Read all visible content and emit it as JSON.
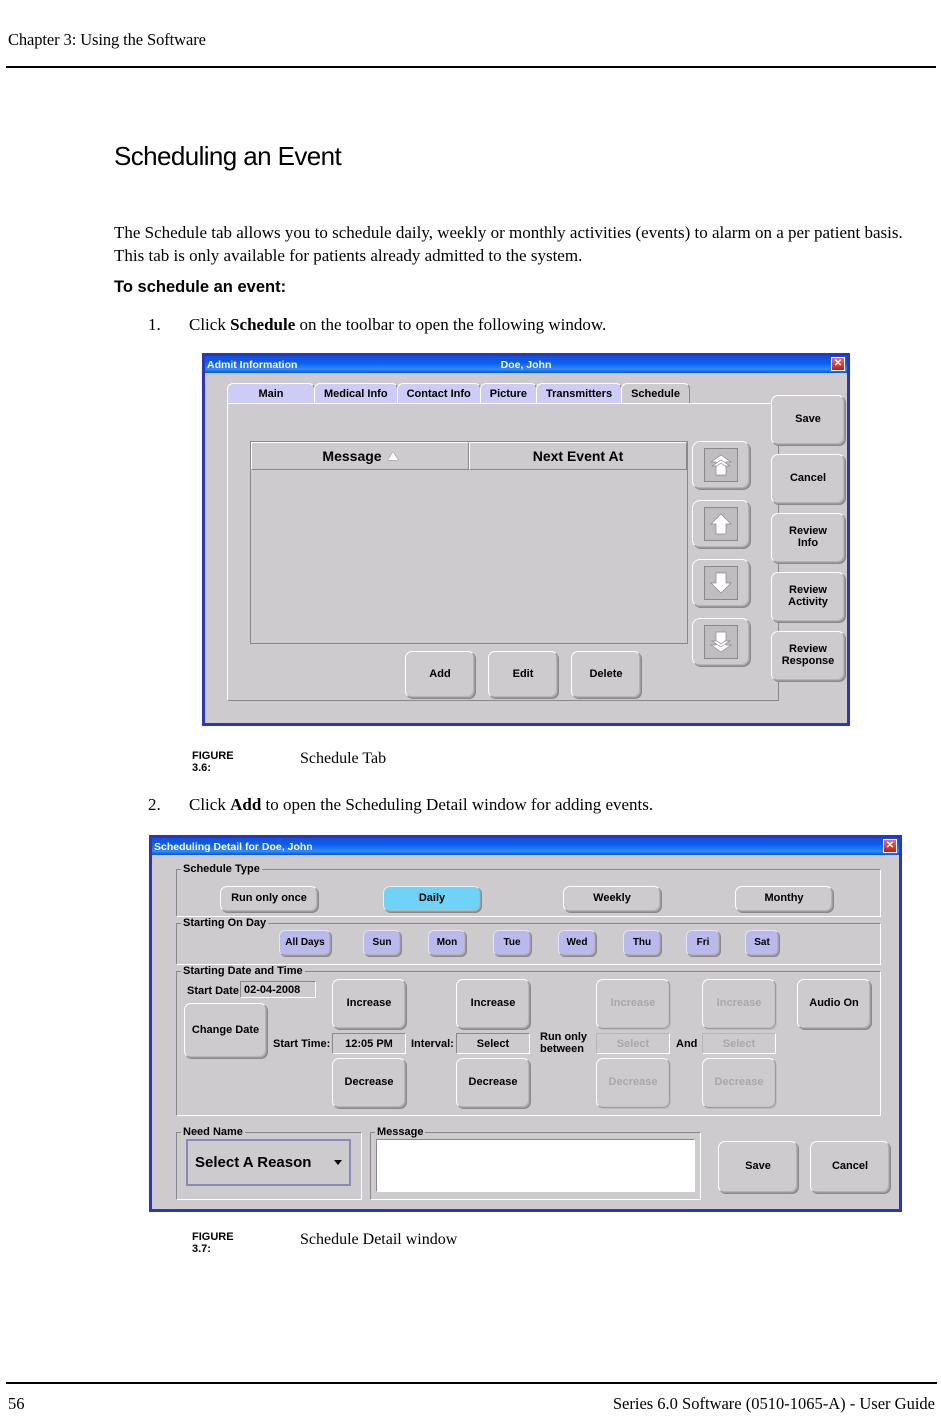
{
  "page": {
    "chapter_header": "Chapter 3: Using the Software",
    "page_number": "56",
    "footer_guide": "Series 6.0 Software (0510-1065-A) - User Guide"
  },
  "content": {
    "heading": "Scheduling an Event",
    "paragraph": "The Schedule tab allows you to schedule daily, weekly or monthly activities (events) to alarm on a per patient basis. This tab is only available for patients already admitted to the system.",
    "subheading": "To schedule an event:",
    "steps": [
      {
        "number": "1.",
        "prefix": "Click ",
        "bold": "Schedule",
        "suffix": " on the toolbar to open the following window."
      },
      {
        "number": "2.",
        "prefix": "Click ",
        "bold": "Add",
        "suffix": " to open the Scheduling Detail window for adding events."
      }
    ],
    "figures": [
      {
        "label": "FIGURE 3.6:",
        "title": "Schedule Tab"
      },
      {
        "label": "FIGURE 3.7:",
        "title": "Schedule Detail window"
      }
    ]
  },
  "admit_window": {
    "title_left": "Admit Information",
    "title_center": "Doe, John",
    "close_label": "✕",
    "tabs": [
      {
        "label": "Main",
        "active": false
      },
      {
        "label": "Medical Info",
        "active": false
      },
      {
        "label": "Contact Info",
        "active": false
      },
      {
        "label": "Picture",
        "active": false
      },
      {
        "label": "Transmitters",
        "active": false
      },
      {
        "label": "Schedule",
        "active": true
      }
    ],
    "grid": {
      "columns": [
        "Message",
        "Next Event At"
      ],
      "sort_column": "Message",
      "sort_direction": "ascending",
      "rows": []
    },
    "nav_buttons": [
      {
        "name": "move-to-top",
        "glyph": "double-chevron-up"
      },
      {
        "name": "move-up",
        "glyph": "arrow-up"
      },
      {
        "name": "move-down",
        "glyph": "arrow-down"
      },
      {
        "name": "move-to-bottom",
        "glyph": "double-chevron-down"
      }
    ],
    "action_buttons": [
      "Add",
      "Edit",
      "Delete"
    ],
    "side_buttons": [
      "Save",
      "Cancel",
      "Review\nInfo",
      "Review\nActivity",
      "Review\nResponse"
    ]
  },
  "scheduling_window": {
    "title_left": "Scheduling Detail for Doe, John",
    "close_label": "✕",
    "schedule_type": {
      "caption": "Schedule Type",
      "options": [
        {
          "label": "Run only once",
          "selected": false
        },
        {
          "label": "Daily",
          "selected": true
        },
        {
          "label": "Weekly",
          "selected": false
        },
        {
          "label": "Monthy",
          "selected": false
        }
      ]
    },
    "starting_on_day": {
      "caption": "Starting On Day",
      "days": [
        "All Days",
        "Sun",
        "Mon",
        "Tue",
        "Wed",
        "Thu",
        "Fri",
        "Sat"
      ]
    },
    "starting_date_time": {
      "caption": "Starting Date and Time",
      "start_date_label": "Start Date:",
      "start_date_value": "02-04-2008",
      "change_date_label": "Change Date",
      "start_time_label": "Start Time:",
      "start_time_value": "12:05 PM",
      "interval_label": "Interval:",
      "interval_value": "Select",
      "run_only_between_label": "Run only\nbetween",
      "and_label": "And",
      "between_from_value": "Select",
      "between_to_value": "Select",
      "increase_label": "Increase",
      "decrease_label": "Decrease",
      "audio_label": "Audio On",
      "spinners": [
        {
          "name": "start-time",
          "enabled": true
        },
        {
          "name": "interval",
          "enabled": true
        },
        {
          "name": "between-from",
          "enabled": false
        },
        {
          "name": "between-to",
          "enabled": false
        }
      ]
    },
    "need_name": {
      "caption": "Need Name",
      "selected_option": "Select A Reason"
    },
    "message": {
      "caption": "Message",
      "value": "",
      "placeholder": ""
    },
    "footer_buttons": [
      "Save",
      "Cancel"
    ]
  },
  "colors": {
    "dialog_border": "#2b36c0",
    "dialog_face": "#cdcbcd",
    "titlebar_blue": "#0b5ff0",
    "close_red": "#c41a11",
    "tab_lavender": "#ccccf4",
    "selected_cyan": "#6fd2f7",
    "day_button_periwinkle": "#b9b9ec",
    "disabled_text": "#a9a7a9"
  }
}
